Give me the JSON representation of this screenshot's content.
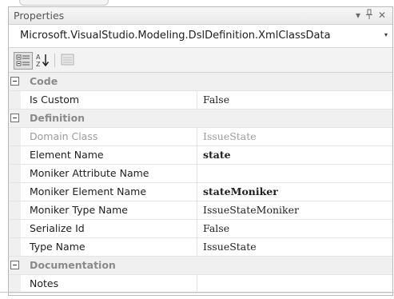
{
  "window": {
    "title": "Properties",
    "buttons": {
      "dropdown": "▾",
      "pin": "ᵩ",
      "close": "✕"
    }
  },
  "object_selector": {
    "value": "Microsoft.VisualStudio.Modeling.DslDefinition.XmlClassData",
    "arrow": "▾"
  },
  "toolbar": {
    "categorized": {
      "icon": "categorized-icon",
      "active": true
    },
    "alphabetical": {
      "icon": "sort-az-icon",
      "active": false
    },
    "property_pages": {
      "icon": "property-pages-icon",
      "active": false
    }
  },
  "categories": [
    {
      "label": "Code",
      "rows": [
        {
          "name": "Is Custom",
          "value": "False",
          "bold": false,
          "disabled": false
        }
      ]
    },
    {
      "label": "Definition",
      "rows": [
        {
          "name": "Domain Class",
          "value": "IssueState",
          "bold": false,
          "disabled": true
        },
        {
          "name": "Element Name",
          "value": "state",
          "bold": true,
          "disabled": false
        },
        {
          "name": "Moniker Attribute Name",
          "value": "",
          "bold": false,
          "disabled": false
        },
        {
          "name": "Moniker Element Name",
          "value": "stateMoniker",
          "bold": true,
          "disabled": false
        },
        {
          "name": "Moniker Type Name",
          "value": "IssueStateMoniker",
          "bold": false,
          "disabled": false
        },
        {
          "name": "Serialize Id",
          "value": "False",
          "bold": false,
          "disabled": false
        },
        {
          "name": "Type Name",
          "value": "IssueState",
          "bold": false,
          "disabled": false
        }
      ]
    },
    {
      "label": "Documentation",
      "rows": [
        {
          "name": "Notes",
          "value": "",
          "bold": false,
          "disabled": false
        }
      ]
    }
  ],
  "colors": {
    "border": "#b9b9b9",
    "category_text": "#8a8a8a",
    "disabled_text": "#9c9c9c"
  }
}
